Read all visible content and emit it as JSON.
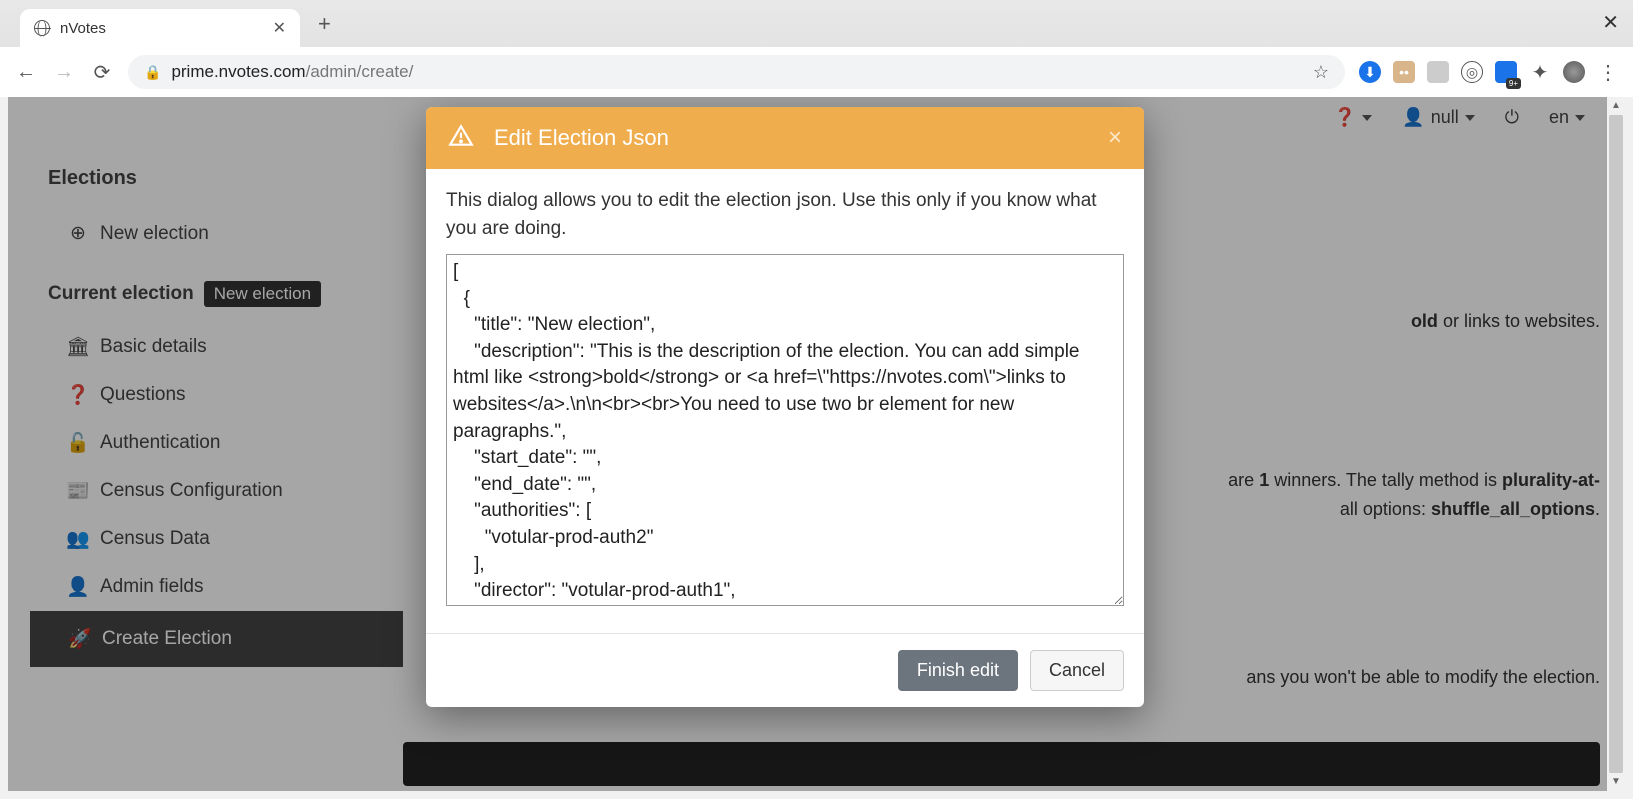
{
  "browser": {
    "tab_title": "nVotes",
    "url_domain": "prime.nvotes.com",
    "url_path": "/admin/create/"
  },
  "topbar": {
    "user_label": "null",
    "lang_label": "en"
  },
  "sidebar": {
    "heading": "Elections",
    "new_election": "New election",
    "current_label": "Current election",
    "current_badge": "New election",
    "items": {
      "basic": "Basic details",
      "questions": "Questions",
      "auth": "Authentication",
      "census_conf": "Census Configuration",
      "census_data": "Census Data",
      "admin_fields": "Admin fields",
      "create": "Create Election"
    }
  },
  "main": {
    "p1_tail": " or links to websites.",
    "p1_bold": "old",
    "p2_a": "are ",
    "p2_b": "1",
    "p2_c": " winners. The tally method is ",
    "p2_d": "plurality-at-",
    "p3_a": "all options: ",
    "p3_b": "shuffle_all_options",
    "p3_c": ".",
    "p4": "ans you won't be able to modify the election."
  },
  "modal": {
    "title": "Edit Election Json",
    "intro": "This dialog allows you to edit the election json. Use this only if you know what you are doing.",
    "json_text": "[\n  {\n    \"title\": \"New election\",\n    \"description\": \"This is the description of the election. You can add simple html like <strong>bold</strong> or <a href=\\\"https://nvotes.com\\\">links to websites</a>.\\n\\n<br><br>You need to use two br element for new paragraphs.\",\n    \"start_date\": \"\",\n    \"end_date\": \"\",\n    \"authorities\": [\n      \"votular-prod-auth2\"\n    ],\n    \"director\": \"votular-prod-auth1\",",
    "finish": "Finish edit",
    "cancel": "Cancel"
  }
}
